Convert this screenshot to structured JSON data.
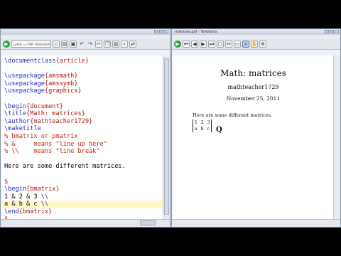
{
  "editor": {
    "title": "",
    "combo_value": "LaTeX => PDF (TeX/LaTeX); PdfLaTeX",
    "lines": [
      {
        "parts": [
          {
            "t": "\\documentclass",
            "c": "cmd"
          },
          {
            "t": "{article}",
            "c": "arg"
          }
        ]
      },
      {
        "parts": []
      },
      {
        "parts": [
          {
            "t": "\\usepackage",
            "c": "cmd"
          },
          {
            "t": "{amsmath}",
            "c": "arg"
          }
        ]
      },
      {
        "parts": [
          {
            "t": "\\usepackage",
            "c": "cmd"
          },
          {
            "t": "{amssymb}",
            "c": "arg"
          }
        ]
      },
      {
        "parts": [
          {
            "t": "\\usepackage",
            "c": "cmd"
          },
          {
            "t": "{graphicx}",
            "c": "arg"
          }
        ]
      },
      {
        "parts": []
      },
      {
        "parts": [
          {
            "t": "\\begin",
            "c": "cmd"
          },
          {
            "t": "{document}",
            "c": "arg"
          }
        ]
      },
      {
        "parts": [
          {
            "t": "\\title",
            "c": "cmd"
          },
          {
            "t": "{Math: matrices}",
            "c": "arg"
          }
        ]
      },
      {
        "parts": [
          {
            "t": "\\author",
            "c": "cmd"
          },
          {
            "t": "{mathteacher1729}",
            "c": "arg"
          }
        ]
      },
      {
        "parts": [
          {
            "t": "\\maketitle",
            "c": "cmd"
          }
        ]
      },
      {
        "parts": [
          {
            "t": "% bmatrix or pmatrix",
            "c": "cm"
          }
        ]
      },
      {
        "parts": [
          {
            "t": "% &     means \"line up here\"",
            "c": "cm"
          }
        ]
      },
      {
        "parts": [
          {
            "t": "% \\\\    means \"line break\"",
            "c": "cm"
          }
        ]
      },
      {
        "parts": []
      },
      {
        "parts": [
          {
            "t": "Here are some different matrices.",
            "c": ""
          }
        ]
      },
      {
        "parts": []
      },
      {
        "parts": [
          {
            "t": "$",
            "c": "cm"
          }
        ]
      },
      {
        "parts": [
          {
            "t": "\\begin",
            "c": "cmd"
          },
          {
            "t": "{bmatrix}",
            "c": "arg"
          }
        ]
      },
      {
        "parts": [
          {
            "t": "1 & 2 & 3 ",
            "c": ""
          },
          {
            "t": "\\\\",
            "c": "cmd"
          }
        ]
      },
      {
        "parts": [
          {
            "t": "a & b & c ",
            "c": ""
          },
          {
            "t": "\\\\",
            "c": "cmd"
          }
        ],
        "highlight": true
      },
      {
        "parts": [
          {
            "t": "\\end",
            "c": "cmd"
          },
          {
            "t": "{bmatrix}",
            "c": "arg"
          }
        ]
      },
      {
        "parts": [
          {
            "t": "$",
            "c": "cm"
          }
        ]
      }
    ]
  },
  "viewer": {
    "title": "matrices.pdf - TeXworks",
    "doc_title": "Math: matrices",
    "doc_author": "mathteacher1729",
    "doc_date": "November 25, 2011",
    "doc_body": "Here are some different matrices.",
    "matrix_rows": [
      [
        "1",
        "2",
        "3"
      ],
      [
        "a",
        "b",
        "c"
      ]
    ]
  },
  "colors": {
    "command": "#1a2bb8",
    "argument": "#b0180e",
    "comment": "#c4260f",
    "highlight": "#fff8c6"
  }
}
